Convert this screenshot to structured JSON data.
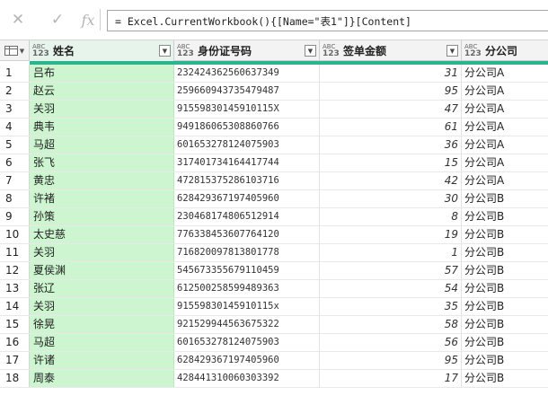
{
  "formula_bar": {
    "cancel_icon": "close-icon",
    "commit_icon": "check-icon",
    "fx_label": "fx",
    "formula": "= Excel.CurrentWorkbook(){[Name=\"表1\"]}[Content]"
  },
  "columns": [
    {
      "type_top": "ABC",
      "type_bottom": "123",
      "label": "姓名"
    },
    {
      "type_top": "ABC",
      "type_bottom": "123",
      "label": "身份证号码"
    },
    {
      "type_top": "ABC",
      "type_bottom": "123",
      "label": "签单金额"
    },
    {
      "type_top": "ABC",
      "type_bottom": "123",
      "label": "分公司"
    }
  ],
  "colors": {
    "accent": "#2ab58e",
    "selected_column": "#ccf5d0"
  },
  "rows": [
    {
      "idx": "1",
      "name": "吕布",
      "id": "232424362560637349",
      "amount": "31",
      "branch": "分公司A"
    },
    {
      "idx": "2",
      "name": "赵云",
      "id": "259660943735479487",
      "amount": "95",
      "branch": "分公司A"
    },
    {
      "idx": "3",
      "name": "关羽",
      "id": "91559830145910115X",
      "amount": "47",
      "branch": "分公司A"
    },
    {
      "idx": "4",
      "name": "典韦",
      "id": "949186065308860766",
      "amount": "61",
      "branch": "分公司A"
    },
    {
      "idx": "5",
      "name": "马超",
      "id": "601653278124075903",
      "amount": "36",
      "branch": "分公司A"
    },
    {
      "idx": "6",
      "name": "张飞",
      "id": "317401734164417744",
      "amount": "15",
      "branch": "分公司A"
    },
    {
      "idx": "7",
      "name": "黄忠",
      "id": "472815375286103716",
      "amount": "42",
      "branch": "分公司A"
    },
    {
      "idx": "8",
      "name": "许褚",
      "id": "628429367197405960",
      "amount": "30",
      "branch": "分公司B"
    },
    {
      "idx": "9",
      "name": "孙策",
      "id": "230468174806512914",
      "amount": "8",
      "branch": "分公司B"
    },
    {
      "idx": "10",
      "name": "太史慈",
      "id": "776338453607764120",
      "amount": "19",
      "branch": "分公司B"
    },
    {
      "idx": "11",
      "name": "关羽",
      "id": "716820097813801778",
      "amount": "1",
      "branch": "分公司B"
    },
    {
      "idx": "12",
      "name": "夏侯渊",
      "id": "545673355679110459",
      "amount": "57",
      "branch": "分公司B"
    },
    {
      "idx": "13",
      "name": "张辽",
      "id": "612500258599489363",
      "amount": "54",
      "branch": "分公司B"
    },
    {
      "idx": "14",
      "name": "关羽",
      "id": "91559830145910115x",
      "amount": "35",
      "branch": "分公司B"
    },
    {
      "idx": "15",
      "name": "徐晃",
      "id": "921529944563675322",
      "amount": "58",
      "branch": "分公司B"
    },
    {
      "idx": "16",
      "name": "马超",
      "id": "601653278124075903",
      "amount": "56",
      "branch": "分公司B"
    },
    {
      "idx": "17",
      "name": "许诸",
      "id": "628429367197405960",
      "amount": "95",
      "branch": "分公司B"
    },
    {
      "idx": "18",
      "name": "周泰",
      "id": "428441310060303392",
      "amount": "17",
      "branch": "分公司B"
    }
  ]
}
